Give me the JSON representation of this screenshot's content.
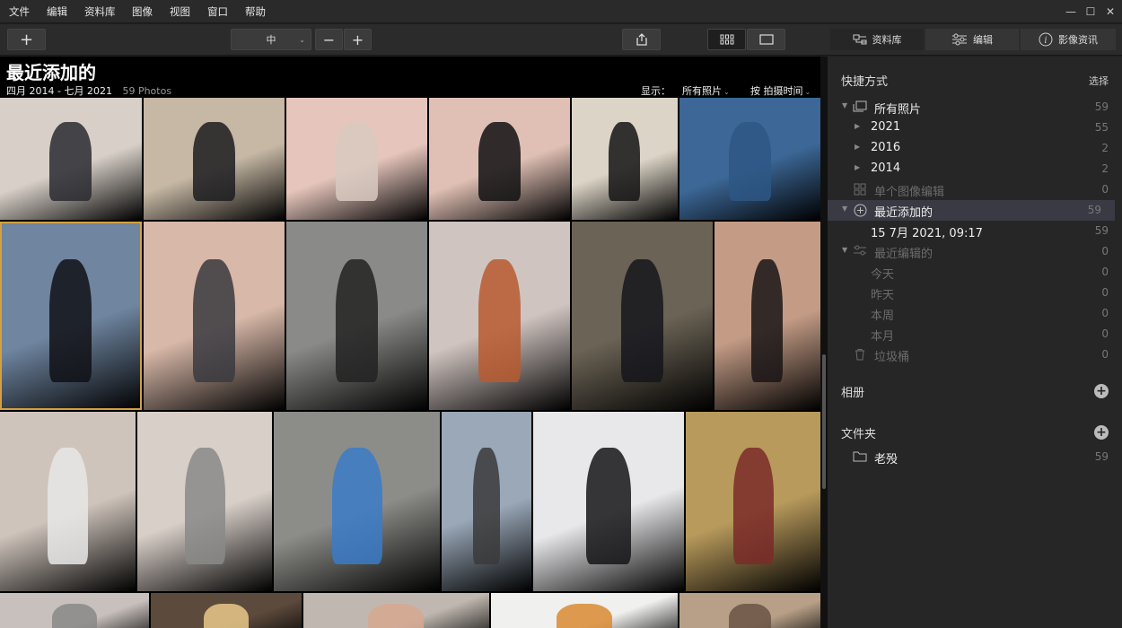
{
  "menu": [
    "文件",
    "编辑",
    "资料库",
    "图像",
    "视图",
    "窗口",
    "帮助"
  ],
  "toolbar": {
    "add_label": "+",
    "size_value": "中",
    "zoom_out": "−",
    "zoom_in": "+"
  },
  "panel_tabs": {
    "library": "资料库",
    "edit": "编辑",
    "info": "影像资讯"
  },
  "main": {
    "title": "最近添加的",
    "date_range": "四月 2014 - 七月 2021",
    "photo_count": "59 Photos",
    "show_label": "显示：",
    "show_value": "所有照片",
    "sort_value": "按 拍摄时间"
  },
  "sidebar": {
    "shortcuts_title": "快捷方式",
    "select_label": "选择",
    "rows": [
      {
        "label": "所有照片",
        "count": "59"
      },
      {
        "label": "2021",
        "count": "55"
      },
      {
        "label": "2016",
        "count": "2"
      },
      {
        "label": "2014",
        "count": "2"
      },
      {
        "label": "单个图像编辑",
        "count": "0"
      },
      {
        "label": "最近添加的",
        "count": "59"
      },
      {
        "label": "15 7月 2021, 09:17",
        "count": "59"
      },
      {
        "label": "最近编辑的",
        "count": "0"
      },
      {
        "label": "今天",
        "count": "0"
      },
      {
        "label": "昨天",
        "count": "0"
      },
      {
        "label": "本周",
        "count": "0"
      },
      {
        "label": "本月",
        "count": "0"
      },
      {
        "label": "垃圾桶",
        "count": "0"
      }
    ],
    "albums_title": "相册",
    "folders_title": "文件夹",
    "folder": {
      "label": "老殁",
      "count": "59"
    }
  },
  "colors": {
    "accent_selected": "#d4a040",
    "sidebar_bg": "#262626",
    "grid_bg": "#000000"
  }
}
